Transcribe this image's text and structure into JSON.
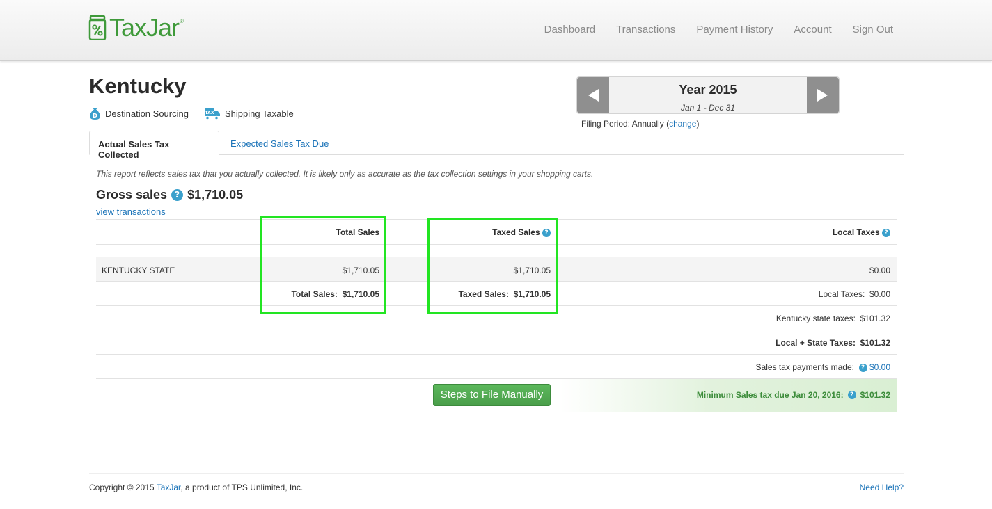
{
  "header": {
    "logo_text": "TaxJar",
    "logo_mark": "®",
    "nav": [
      "Dashboard",
      "Transactions",
      "Payment History",
      "Account",
      "Sign Out"
    ]
  },
  "page": {
    "title": "Kentucky",
    "badges": [
      {
        "label": "Destination Sourcing",
        "icon": "money-bag-icon"
      },
      {
        "label": "Shipping Taxable",
        "icon": "tax-truck-icon"
      }
    ]
  },
  "year_selector": {
    "year": "Year 2015",
    "range": "Jan 1 - Dec 31",
    "filing_prefix": "Filing Period: Annually (",
    "filing_link": "change",
    "filing_suffix": ")"
  },
  "tabs": [
    "Actual Sales Tax Collected",
    "Expected Sales Tax Due"
  ],
  "report": {
    "note": "This report reflects sales tax that you actually collected. It is likely only as accurate as the tax collection settings in your shopping carts.",
    "gross_label": "Gross sales",
    "gross_value": "$1,710.05",
    "view_transactions": "view transactions",
    "columns": {
      "total_sales": "Total Sales",
      "taxed_sales": "Taxed Sales",
      "local_taxes": "Local Taxes"
    },
    "state_row": {
      "name": "KENTUCKY STATE",
      "total_sales": "$1,710.05",
      "taxed_sales": "$1,710.05",
      "local_taxes": "$0.00"
    },
    "totals": {
      "total_sales_label": "Total Sales:",
      "total_sales_value": "$1,710.05",
      "taxed_sales_label": "Taxed Sales:",
      "taxed_sales_value": "$1,710.05",
      "local_taxes_label": "Local Taxes:",
      "local_taxes_value": "$0.00"
    },
    "state_taxes_label": "Kentucky state taxes:",
    "state_taxes_value": "$101.32",
    "local_state_label": "Local + State Taxes:",
    "local_state_value": "$101.32",
    "payments_label": "Sales tax payments made:",
    "payments_value": "$0.00",
    "steps_button": "Steps to File Manually",
    "minimum_label": "Minimum Sales tax due Jan 20, 2016:",
    "minimum_value": "$101.32"
  },
  "footer": {
    "copyright_prefix": "Copyright © 2015 ",
    "copyright_link": "TaxJar",
    "copyright_suffix": ", a product of TPS Unlimited, Inc.",
    "help": "Need Help?"
  },
  "colors": {
    "brand_green": "#3f9a3a",
    "link_blue": "#1a73b8",
    "highlight": "#22e522",
    "help_icon": "#3aa0cc"
  }
}
